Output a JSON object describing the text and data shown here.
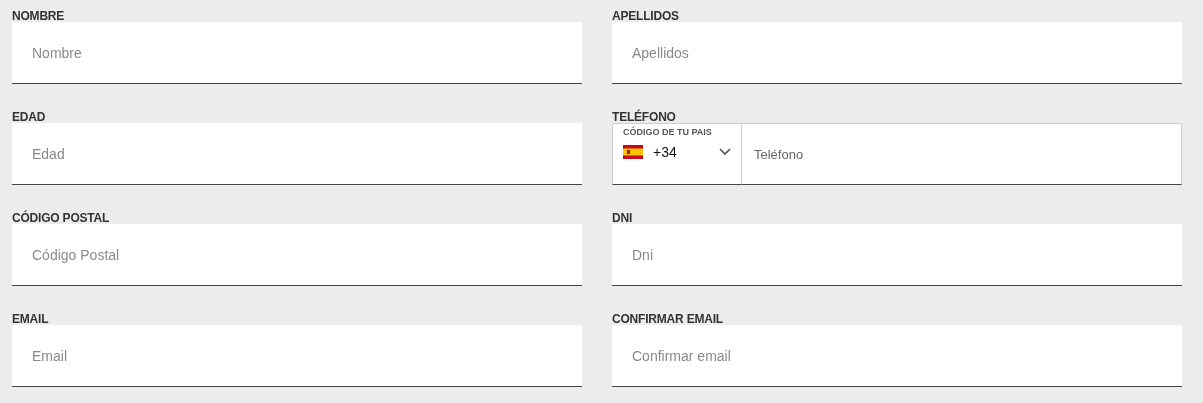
{
  "fields": [
    {
      "kind": "text",
      "label": "NOMBRE",
      "placeholder": "Nombre"
    },
    {
      "kind": "text",
      "label": "APELLIDOS",
      "placeholder": "Apellidos"
    },
    {
      "kind": "text",
      "label": "EDAD",
      "placeholder": "Edad"
    },
    {
      "kind": "phone",
      "label": "TELÉFONO",
      "country_label": "CÓDIGO DE TU PAIS",
      "code": "+34",
      "placeholder": "Teléfono"
    },
    {
      "kind": "text",
      "label": "CÓDIGO POSTAL",
      "placeholder": "Código Postal"
    },
    {
      "kind": "text",
      "label": "DNI",
      "placeholder": "Dni"
    },
    {
      "kind": "text",
      "label": "EMAIL",
      "placeholder": "Email"
    },
    {
      "kind": "text",
      "label": "CONFIRMAR EMAIL",
      "placeholder": "Confirmar email"
    }
  ]
}
